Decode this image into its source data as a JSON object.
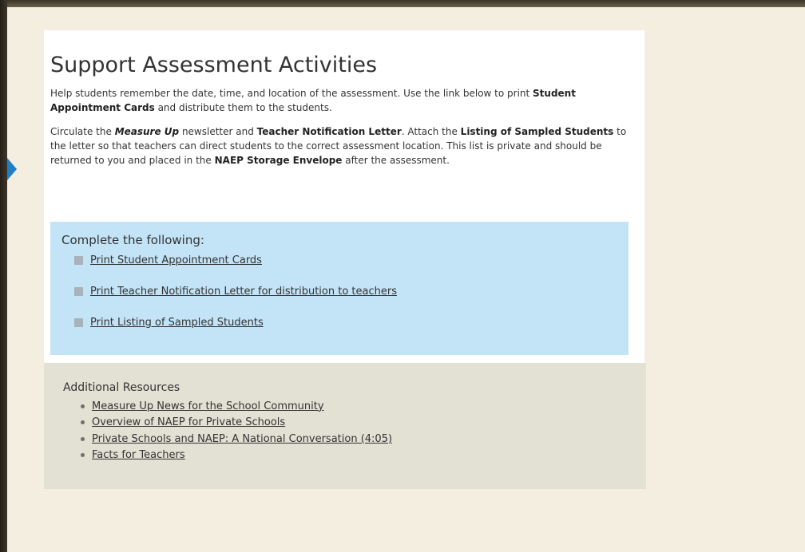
{
  "main": {
    "title": "Support Assessment Activities",
    "paragraph1": [
      {
        "text": "Help students remember the date, time, and location of the assessment. Use the link below to print "
      },
      {
        "text": "Student Appointment Cards",
        "bold": true
      },
      {
        "text": " and distribute them to the students."
      }
    ],
    "paragraph2": [
      {
        "text": "Circulate the "
      },
      {
        "text": "Measure Up",
        "bold": true,
        "italic": true
      },
      {
        "text": " newsletter and "
      },
      {
        "text": "Teacher Notification Letter",
        "bold": true
      },
      {
        "text": ". Attach the "
      },
      {
        "text": "Listing of Sampled Students",
        "bold": true
      },
      {
        "text": " to the letter so that teachers can direct students to the correct assessment location. This list is private and should be returned to you and placed in the "
      },
      {
        "text": "NAEP Storage Envelope",
        "bold": true
      },
      {
        "text": " after the assessment."
      }
    ]
  },
  "tasks": {
    "heading": "Complete the following:",
    "items": [
      {
        "label": "Print Student Appointment Cards"
      },
      {
        "label": "Print Teacher Notification Letter for distribution to teachers"
      },
      {
        "label": "Print Listing of Sampled Students"
      }
    ]
  },
  "resources": {
    "heading": "Additional Resources",
    "items": [
      {
        "label": "Measure Up News for the School Community"
      },
      {
        "label": "Overview of NAEP for Private Schools"
      },
      {
        "label": "Private Schools and NAEP: A National Conversation (4:05)"
      },
      {
        "label": "Facts for Teachers"
      }
    ]
  },
  "colors": {
    "page_background": "#f3eedf",
    "task_panel": "#c3e3f6",
    "resources_panel": "#e3e0d4",
    "accent_arrow": "#1f7fc4"
  }
}
